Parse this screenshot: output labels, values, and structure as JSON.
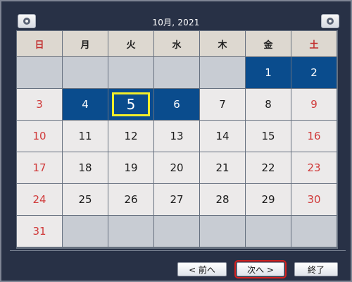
{
  "header": {
    "title": "10月, 2021",
    "prev_icon": "circle-dot-icon",
    "next_icon": "circle-dot-icon"
  },
  "weekdays": [
    "日",
    "月",
    "火",
    "水",
    "木",
    "金",
    "土"
  ],
  "weeks": [
    [
      "",
      "",
      "",
      "",
      "",
      "1",
      "2"
    ],
    [
      "3",
      "4",
      "5",
      "6",
      "7",
      "8",
      "9"
    ],
    [
      "10",
      "11",
      "12",
      "13",
      "14",
      "15",
      "16"
    ],
    [
      "17",
      "18",
      "19",
      "20",
      "21",
      "22",
      "23"
    ],
    [
      "24",
      "25",
      "26",
      "27",
      "28",
      "29",
      "30"
    ],
    [
      "31",
      "",
      "",
      "",
      "",
      "",
      ""
    ]
  ],
  "selected_days": [
    "1",
    "2",
    "4",
    "5",
    "6"
  ],
  "today": "5",
  "buttons": {
    "prev": "< 前へ",
    "next": "次へ >",
    "end": "終了"
  },
  "colors": {
    "accent_selected": "#0a4c8d",
    "today_outline": "#f2ee2a",
    "weekend_text": "#d03a3a",
    "next_highlight": "#d3201f"
  }
}
